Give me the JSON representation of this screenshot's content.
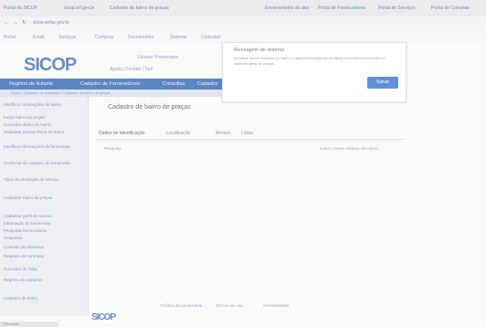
{
  "browser": {
    "tabs": [
      "Portal do SICOP",
      "sicop.srf.gov.br",
      "Cadastro do bairro de praças",
      "Encerramento da aba",
      "Portal de Fornecedores",
      "Portal de Serviços",
      "Portal de Compras"
    ],
    "address": "sicop.sefaz.gov.br",
    "bookmarks": [
      "Portal",
      "Email",
      "Serviços",
      "Compras",
      "Documentos",
      "Sistema",
      "Contratos"
    ]
  },
  "header": {
    "logo": "SICOP",
    "logo_pre": "",
    "user_text": "Usuário: Fornecedor",
    "links_text": "Ajuda  |  Contato  |  Sair"
  },
  "menu": {
    "items": [
      "Registro de licitante",
      "Cadastro de Fornecedores",
      "Consultas",
      "Cadastro"
    ],
    "subbar": "Início  >  Cadastro de licitantes  >  Cadastro de bairro de praças"
  },
  "sidebar": {
    "items": [
      "Modificar informações de bairro",
      "Incluir bairro no projeto",
      "Consultar dados do bairro",
      "Cadastrar pessoa física do bairro",
      "Modificar informações do fornecedor",
      "Confirmar de cadastro do fornecedor",
      "Tipos de prestação de serviço",
      "Cadastrar bairro de praças",
      "Cadastrar perfil de acesso",
      "Informação do fornecedor",
      "Pesquisar fornecedores",
      "Relatórios",
      "Consulta de relatórios",
      "Relatório de contratos",
      "Consultar de listas",
      "Registro de unidades",
      "Cadastro de bairro"
    ]
  },
  "main": {
    "title": "Cadastro de bairro de praças",
    "tabs": [
      "Dados de identificação",
      "Localização",
      "Anexos",
      "Listas"
    ],
    "toolbar_left": "Pesquisa",
    "toolbar_right": "Incluir  |  Gerar relatório de bairro"
  },
  "modal": {
    "title": "Mensagem do sistema",
    "text": "Ao salvar as informações do bairro, o sistema irá registrar os dados e confirmar a inclusão no cadastro geral de praças.",
    "button": "Salvar"
  },
  "footer": {
    "links": [
      "Política de privacidade",
      "Termos de uso",
      "Acessibilidade"
    ],
    "logo": "SICOP"
  },
  "bottom_status": "Conectado"
}
